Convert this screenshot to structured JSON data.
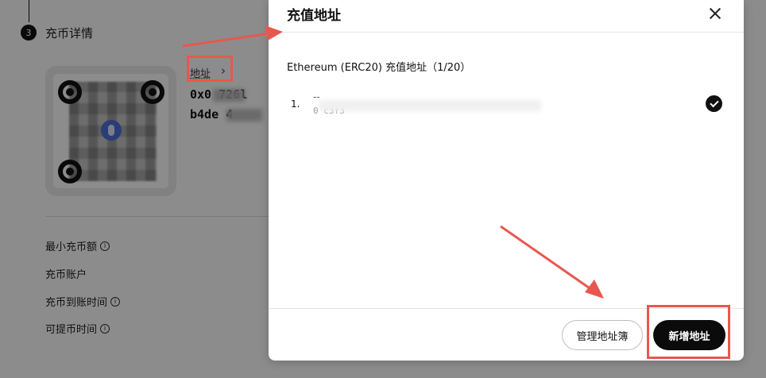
{
  "background": {
    "step_number": "3",
    "step_title": "充币详情",
    "address_link": "地址",
    "address_line1": "0x0     726l",
    "address_line2": "b4de       4",
    "info_rows": [
      {
        "label": "最小充币额",
        "has_info_icon": true
      },
      {
        "label": "充币账户",
        "has_info_icon": false
      },
      {
        "label": "充币到账时间",
        "has_info_icon": true
      },
      {
        "label": "可提币时间",
        "has_info_icon": true
      }
    ]
  },
  "modal": {
    "title": "充值地址",
    "network_label": "Ethereum (ERC20) 充值地址（1/20）",
    "addresses": [
      {
        "index": "1.",
        "name": "--",
        "address_visible": "0                                  c3f3",
        "selected": true
      }
    ],
    "manage_button": "管理地址簿",
    "add_button": "新增地址"
  },
  "colors": {
    "highlight": "#e8574f",
    "primary_button": "#0b0b0b",
    "overlay": "rgba(0,0,0,0.45)"
  }
}
